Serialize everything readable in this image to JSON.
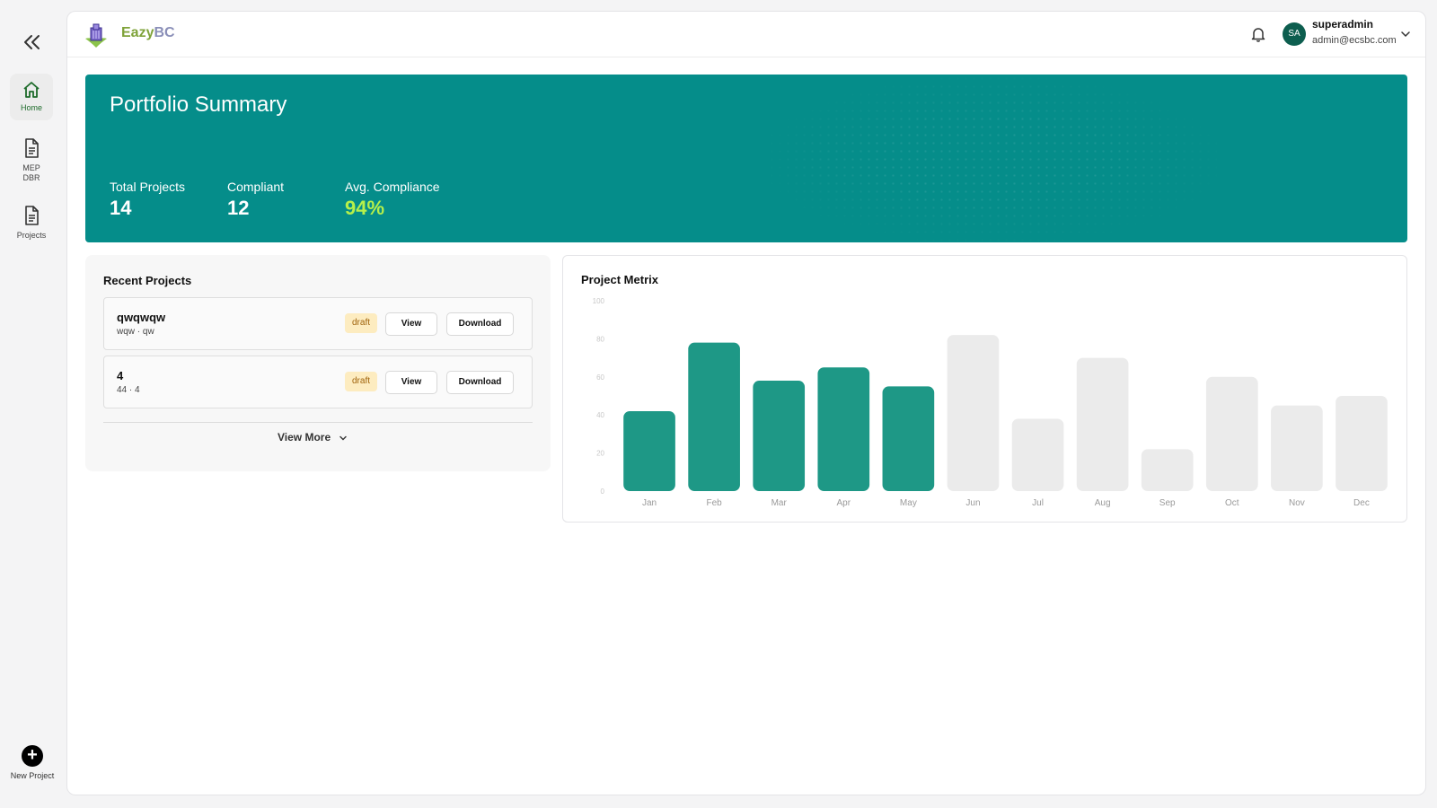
{
  "sidebar": {
    "items": [
      {
        "label": "Home",
        "icon": "home-icon",
        "active": true
      },
      {
        "label": "MEP DBR",
        "icon": "document-icon",
        "active": false
      },
      {
        "label": "Projects",
        "icon": "document-icon",
        "active": false
      }
    ],
    "new_project_label": "New Project"
  },
  "header": {
    "brand_part1": "Eazy",
    "brand_part2": "BC",
    "avatar_initials": "SA",
    "user_name": "superadmin",
    "user_email": "admin@ecsbc.com"
  },
  "banner": {
    "title": "Portfolio Summary",
    "stats": [
      {
        "label": "Total Projects",
        "value": "14"
      },
      {
        "label": "Compliant",
        "value": "12"
      },
      {
        "label": "Avg. Compliance",
        "value": "94%"
      }
    ]
  },
  "recent": {
    "title": "Recent Projects",
    "projects": [
      {
        "name": "qwqwqw",
        "subtitle": "wqw · qw",
        "status": "draft",
        "view_label": "View",
        "download_label": "Download"
      },
      {
        "name": "4",
        "subtitle": "44 · 4",
        "status": "draft",
        "view_label": "View",
        "download_label": "Download"
      }
    ],
    "view_more_label": "View More"
  },
  "colors": {
    "accent": "#058d8a",
    "bar_active": "#1e9886",
    "bar_inactive": "#ebebeb",
    "highlight": "#b6f04a"
  },
  "chart_data": {
    "type": "bar",
    "title": "Project Metrix",
    "categories": [
      "Jan",
      "Feb",
      "Mar",
      "Apr",
      "May",
      "Jun",
      "Jul",
      "Aug",
      "Sep",
      "Oct",
      "Nov",
      "Dec"
    ],
    "values": [
      42,
      78,
      58,
      65,
      55,
      82,
      38,
      70,
      22,
      60,
      45,
      50
    ],
    "highlighted": [
      true,
      true,
      true,
      true,
      true,
      false,
      false,
      false,
      false,
      false,
      false,
      false
    ],
    "yticks": [
      0,
      20,
      40,
      60,
      80,
      100
    ],
    "ylim": [
      0,
      100
    ],
    "grid": false,
    "xlabel": "",
    "ylabel": ""
  }
}
